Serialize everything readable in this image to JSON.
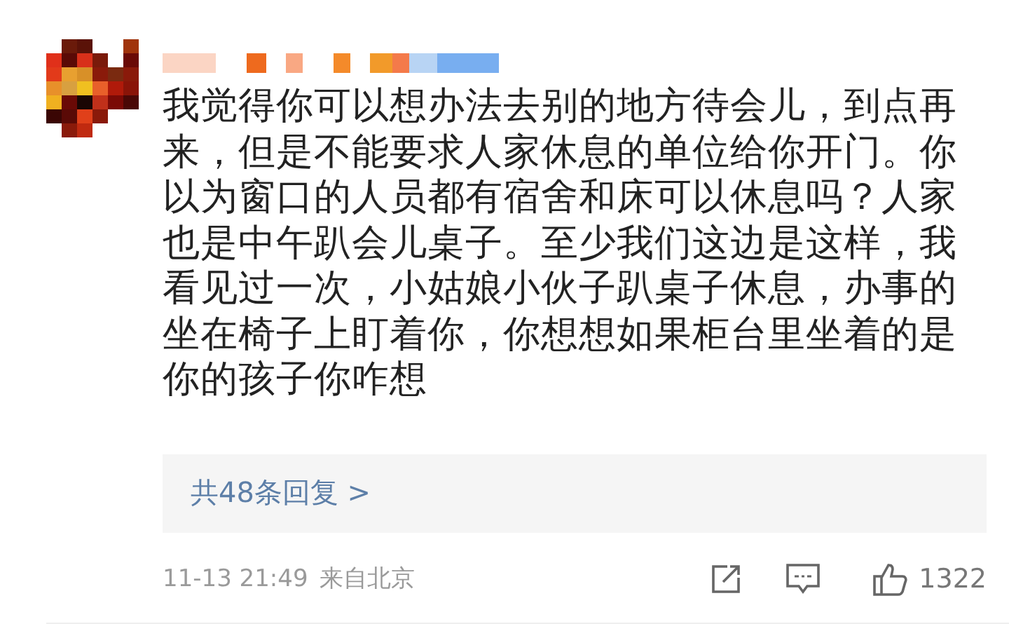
{
  "comment": {
    "body": "我觉得你可以想办法去别的地方待会儿，到点再来，但是不能要求人家休息的单位给你开门。你以为窗口的人员都有宿舍和床可以休息吗？人家也是中午趴会儿桌子。至少我们这边是这样，我看见过一次，小姑娘小伙子趴桌子休息，办事的坐在椅子上盯着你，你想想如果柜台里坐着的是你的孩子你咋想",
    "replies_link": "共48条回复 >",
    "timestamp": "11-13 21:49",
    "source": "来自北京",
    "like_count": "1322"
  }
}
